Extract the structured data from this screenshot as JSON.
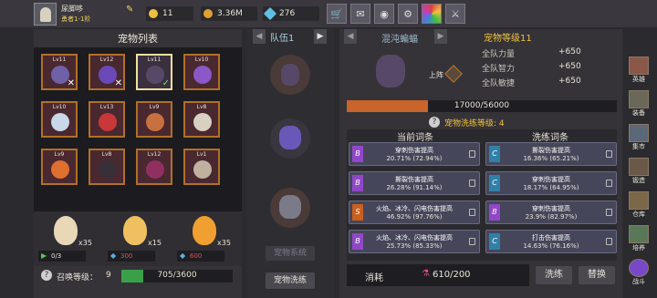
{
  "player": {
    "name": "尿脚哆",
    "rank": "勇者1-1阶"
  },
  "resources": [
    {
      "id": "coin",
      "value": "11",
      "color": "#f0c040"
    },
    {
      "id": "gold",
      "value": "3.36M",
      "color": "#e0a030"
    },
    {
      "id": "gem",
      "value": "276",
      "color": "#60c0e0"
    }
  ],
  "top_icons": [
    "shop-icon",
    "mail-icon",
    "gamepad-icon",
    "gear-icon",
    "rainbow-icon",
    "sword-icon"
  ],
  "pet_list": {
    "title": "宠物列表",
    "pets": [
      {
        "lv": "Lv11",
        "color": "#7060a8",
        "mark": "✕"
      },
      {
        "lv": "Lv12",
        "color": "#6a4ab8",
        "mark": "✕"
      },
      {
        "lv": "Lv11",
        "color": "#584868",
        "mark": "✓"
      },
      {
        "lv": "Lv10",
        "color": "#8a58c8",
        "mark": ""
      },
      {
        "lv": "Lv10",
        "color": "#c8d8e8",
        "mark": ""
      },
      {
        "lv": "Lv13",
        "color": "#c83838",
        "mark": ""
      },
      {
        "lv": "Lv9",
        "color": "#c87040",
        "mark": ""
      },
      {
        "lv": "Lv8",
        "color": "#d8d0c0",
        "mark": ""
      },
      {
        "lv": "Lv9",
        "color": "#e07030",
        "mark": ""
      },
      {
        "lv": "Lv8",
        "color": "#383038",
        "mark": ""
      },
      {
        "lv": "Lv12",
        "color": "#903060",
        "mark": ""
      },
      {
        "lv": "Lv1",
        "color": "#c0b0a0",
        "mark": ""
      }
    ]
  },
  "eggs": [
    {
      "count": "x35",
      "tag": "0/3",
      "color": "#e8d8b8"
    },
    {
      "count": "x15",
      "tag": "300",
      "color": "#f0c060"
    },
    {
      "count": "x35",
      "tag": "600",
      "color": "#f0a030"
    }
  ],
  "summon": {
    "label": "召唤等级：",
    "level": "9",
    "progress": "705/3600",
    "fraction": 0.196
  },
  "team": {
    "label": "队伍1",
    "level_btn": "宠物系统",
    "refine_btn": "宠物洗练"
  },
  "detail": {
    "name": "混沌蝙蝠",
    "level": "宠物等级11",
    "stats": [
      {
        "label": "全队力量",
        "value": "+650"
      },
      {
        "label": "全队智力",
        "value": "+650"
      },
      {
        "label": "全队敏捷",
        "value": "+650"
      }
    ],
    "deploy": "上阵",
    "exp": "17000/56000",
    "exp_fraction": 0.3,
    "refine_level": "宠物洗练等级: 4"
  },
  "entries": {
    "current_title": "当前词条",
    "refine_title": "洗练词条",
    "current": [
      {
        "badge": "B",
        "name": "穿刺伤害提高",
        "value": "20.71% (72.94%)",
        "color": "#9048c8"
      },
      {
        "badge": "B",
        "name": "撕裂伤害提高",
        "value": "26.28% (91.14%)",
        "color": "#9048c8"
      },
      {
        "badge": "S",
        "name": "火焰、冰冷、闪电伤害提高",
        "value": "46.92% (97.76%)",
        "color": "#c86020"
      },
      {
        "badge": "B",
        "name": "火焰、冰冷、闪电伤害提高",
        "value": "25.73% (85.33%)",
        "color": "#9048c8"
      }
    ],
    "refine": [
      {
        "badge": "C",
        "name": "撕裂伤害提高",
        "value": "16.36% (65.21%)",
        "color": "#3080a8"
      },
      {
        "badge": "C",
        "name": "穿刺伤害提高",
        "value": "18.17% (64.95%)",
        "color": "#3080a8"
      },
      {
        "badge": "B",
        "name": "穿刺伤害提高",
        "value": "23.9% (82.97%)",
        "color": "#9048c8"
      },
      {
        "badge": "C",
        "name": "打击伤害提高",
        "value": "14.63% (76.16%)",
        "color": "#3080a8"
      }
    ]
  },
  "cost": {
    "label": "消耗",
    "value": "610/200"
  },
  "actions": {
    "refine": "洗练",
    "replace": "替换"
  },
  "sidebar": [
    {
      "label": "英雄",
      "icon": "hero-icon"
    },
    {
      "label": "装备",
      "icon": "equipment-icon"
    },
    {
      "label": "集市",
      "icon": "market-icon"
    },
    {
      "label": "锻造",
      "icon": "forge-icon"
    },
    {
      "label": "仓库",
      "icon": "warehouse-icon"
    },
    {
      "label": "培养",
      "icon": "train-icon"
    },
    {
      "label": "战斗",
      "icon": "battle-icon"
    }
  ]
}
